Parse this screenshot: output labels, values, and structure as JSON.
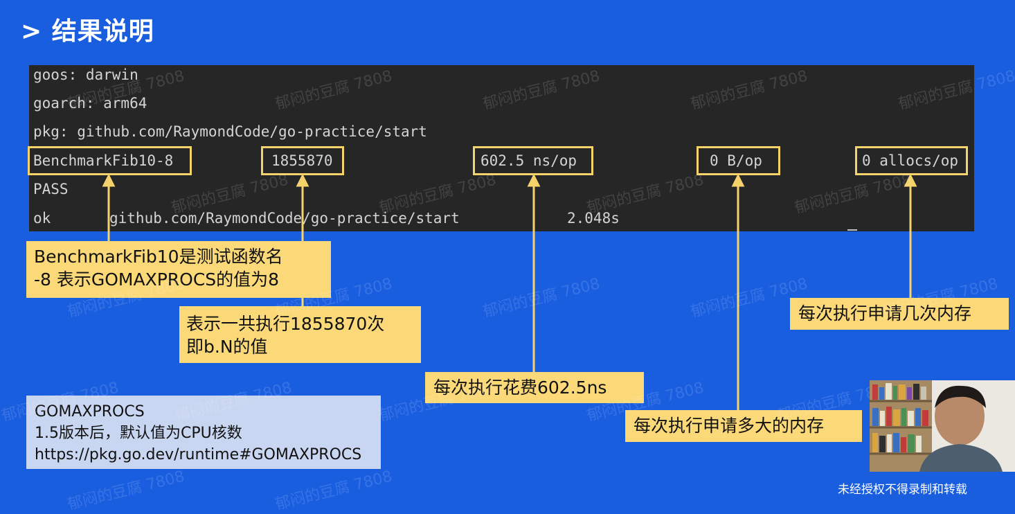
{
  "slide": {
    "title": "> 结果说明"
  },
  "terminal": {
    "lines": {
      "goos": "goos: darwin",
      "goarch": "goarch: arm64",
      "pkg": "pkg: github.com/RaymondCode/go-practice/start",
      "pass": "PASS",
      "ok": "ok",
      "ok_path": "github.com/RaymondCode/go-practice/start",
      "ok_time": "2.048s"
    },
    "benchmark": {
      "name": "BenchmarkFib10-8",
      "iterations": "1855870",
      "ns_per_op": "602.5 ns/op",
      "bytes_per_op": "0 B/op",
      "allocs_per_op": "0 allocs/op"
    }
  },
  "callouts": {
    "name": {
      "line1": "BenchmarkFib10是测试函数名",
      "line2": "-8 表示GOMAXPROCS的值为8"
    },
    "iterations": {
      "line1": "表示一共执行1855870次",
      "line2": "即b.N的值"
    },
    "ns_per_op": "每次执行花费602.5ns",
    "bytes_per_op": "每次执行申请多大的内存",
    "allocs_per_op": "每次执行申请几次内存"
  },
  "info": {
    "heading": "GOMAXPROCS",
    "line2": "1.5版本后，默认值为CPU核数",
    "url": "https://pkg.go.dev/runtime#GOMAXPROCS"
  },
  "watermark": "郁闷的豆腐 7808",
  "footer": "未经授权不得录制和转载",
  "colors": {
    "background": "#1a5ee0",
    "terminal": "#262626",
    "highlight": "#f5d36b",
    "callout": "#fbd978",
    "info_box": "#c9d6f1"
  }
}
